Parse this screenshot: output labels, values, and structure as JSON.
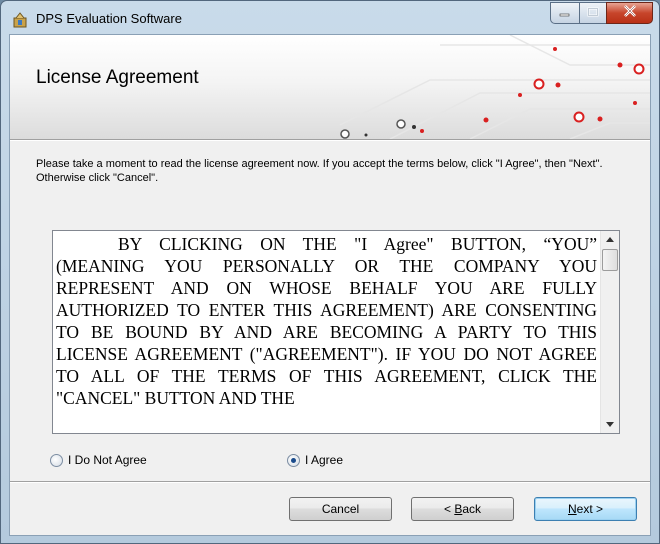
{
  "window": {
    "title": "DPS Evaluation Software",
    "icon": "installer-package-icon"
  },
  "caption_buttons": {
    "minimize_icon": "minimize-icon",
    "maximize_icon": "maximize-icon",
    "close_icon": "close-icon"
  },
  "banner": {
    "title": "License Agreement"
  },
  "instruction": "Please take a moment to read the license agreement now. If you accept the terms below, click \"I Agree\", then \"Next\". Otherwise click \"Cancel\".",
  "license": {
    "text": "BY CLICKING ON THE \"I Agree\" BUTTON, “YOU” (MEANING YOU PERSONALLY OR THE COMPANY YOU REPRESENT AND ON WHOSE BEHALF YOU ARE FULLY AUTHORIZED TO ENTER THIS AGREEMENT) ARE CONSENTING TO BE BOUND BY AND ARE BECOMING A PARTY TO THIS LICENSE AGREEMENT (\"AGREEMENT\"). IF YOU DO NOT AGREE TO ALL OF THE TERMS OF THIS AGREEMENT, CLICK THE \"CANCEL\" BUTTON AND THE"
  },
  "options": {
    "do_not_agree": "I Do Not Agree",
    "agree": "I Agree",
    "selected": "agree"
  },
  "buttons": {
    "cancel": "Cancel",
    "back_prefix": "< ",
    "back_key": "B",
    "back_rest": "ack",
    "next_key": "N",
    "next_rest": "ext >"
  },
  "colors": {
    "circuit_red": "#d92020",
    "titlebar": "#c9dbea",
    "close_button": "#c7452b"
  }
}
